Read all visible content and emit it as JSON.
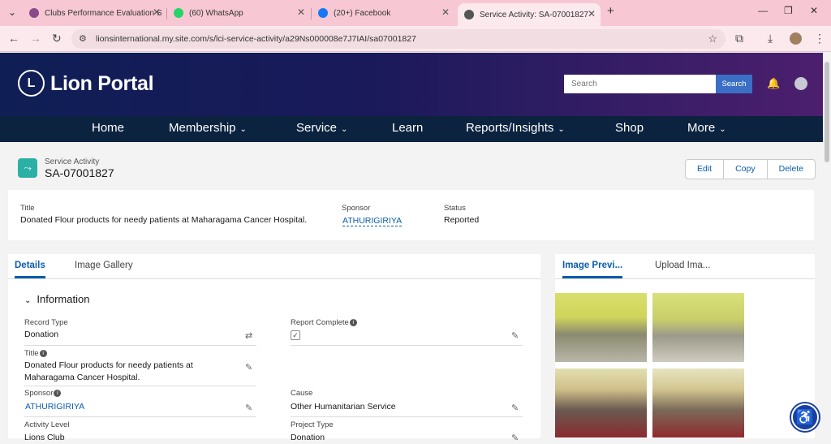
{
  "browser": {
    "tabs": [
      {
        "title": "Clubs Performance Evaluation S",
        "favicon_color": "#8a4a8a"
      },
      {
        "title": "(60) WhatsApp",
        "favicon_color": "#25d366"
      },
      {
        "title": "(20+) Facebook",
        "favicon_color": "#1877f2"
      },
      {
        "title": "Service Activity: SA-07001827",
        "favicon_color": "#555555"
      }
    ],
    "url": "lionsinternational.my.site.com/s/lci-service-activity/a29Ns000008e7J7IAI/sa07001827",
    "new_tab": "+",
    "minimize": "—",
    "maximize": "❐",
    "close": "✕"
  },
  "header": {
    "logo_text": "Lion Portal",
    "search_placeholder": "Search",
    "search_button": "Search"
  },
  "nav": {
    "items": [
      "Home",
      "Membership",
      "Service",
      "Learn",
      "Reports/Insights",
      "Shop",
      "More"
    ]
  },
  "record": {
    "object_label": "Service Activity",
    "name": "SA-07001827",
    "actions": [
      "Edit",
      "Copy",
      "Delete"
    ]
  },
  "highlights": {
    "title_label": "Title",
    "title_value": "Donated Flour products for needy patients at Maharagama Cancer Hospital.",
    "sponsor_label": "Sponsor",
    "sponsor_value": "ATHURIGIRIYA",
    "status_label": "Status",
    "status_value": "Reported"
  },
  "details": {
    "tabs": [
      "Details",
      "Image Gallery"
    ],
    "section": "Information",
    "record_type_label": "Record Type",
    "record_type_value": "Donation",
    "report_complete_label": "Report Complete",
    "title_label": "Title",
    "title_value": "Donated Flour products for needy patients at Maharagama Cancer Hospital.",
    "sponsor_label": "Sponsor",
    "sponsor_value": "ATHURIGIRIYA",
    "cause_label": "Cause",
    "cause_value": "Other Humanitarian Service",
    "activity_level_label": "Activity Level",
    "activity_level_value": "Lions Club",
    "project_type_label": "Project Type",
    "project_type_value": "Donation"
  },
  "side": {
    "tabs": [
      "Image Previ...",
      "Upload Ima..."
    ]
  }
}
